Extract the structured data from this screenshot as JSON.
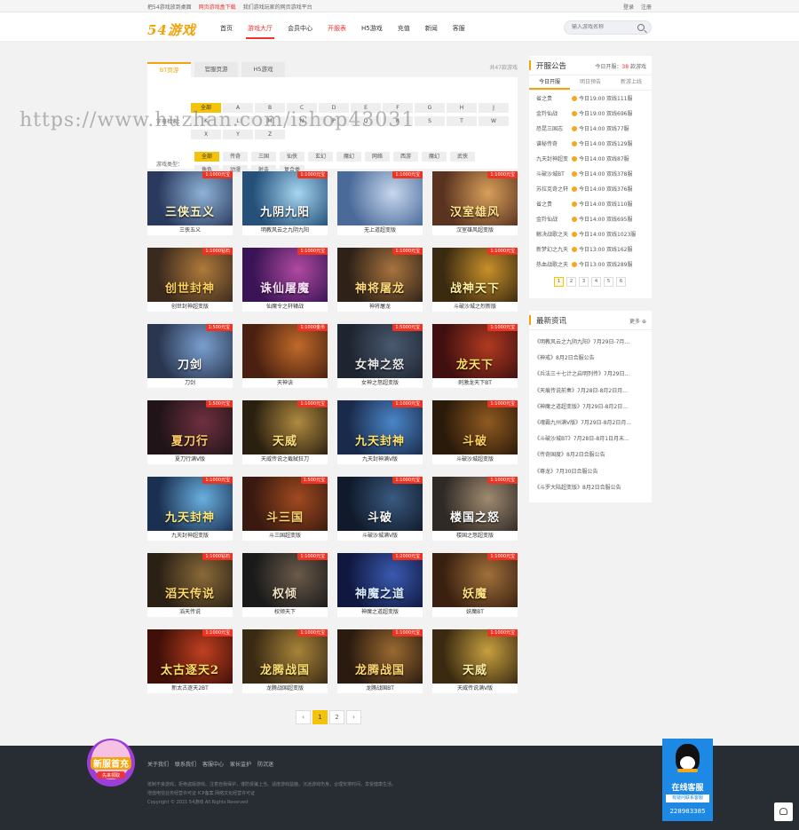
{
  "topbar": {
    "left": [
      "把54游戏放到桌面",
      "网页游戏盒下载",
      "我们游戏玩家的网页游戏平台"
    ],
    "right": [
      "登录",
      "注册"
    ]
  },
  "header": {
    "logo": "54游戏",
    "nav": [
      "首页",
      "游戏大厅",
      "会员中心",
      "开服表",
      "H5游戏",
      "充值",
      "新闻",
      "客服"
    ],
    "search_placeholder": "输入游戏名称"
  },
  "main": {
    "tabs": [
      "BT页游",
      "官服页游",
      "H5游戏"
    ],
    "total": "共47款游戏",
    "filter": {
      "letter_label": "字母检索：",
      "letters": [
        "全部",
        "A",
        "B",
        "C",
        "D",
        "E",
        "F",
        "G",
        "H",
        "J",
        "K",
        "L",
        "M",
        "N",
        "P",
        "Q",
        "R",
        "S",
        "T",
        "W",
        "X",
        "Y",
        "Z"
      ],
      "type_label": "游戏类型：",
      "types": [
        "全部",
        "传奇",
        "三国",
        "仙侠",
        "玄幻",
        "魔幻",
        "网络",
        "西游",
        "魔幻",
        "武侠",
        "角色",
        "动漫",
        "射击",
        "复合类"
      ]
    },
    "games": [
      {
        "name": "三侠五义",
        "badge": "1:1000元宝",
        "art": "三侠五义"
      },
      {
        "name": "明教风云之九阴九阳",
        "badge": "1:1000元宝",
        "art": "九阴九阳"
      },
      {
        "name": "无上道超变版",
        "badge": "1:1000元宝",
        "art": ""
      },
      {
        "name": "汉室雄风超变版",
        "badge": "1:1000元宝",
        "art": "汉室雄风"
      },
      {
        "name": "创世封神超变版",
        "badge": "1:1000钻石",
        "art": "创世封神"
      },
      {
        "name": "仙魔令之轩辕战",
        "badge": "1:1000元宝",
        "art": "诛仙屠魔"
      },
      {
        "name": "神将屠龙",
        "badge": "1:1000元宝",
        "art": "神将屠龙"
      },
      {
        "name": "斗破沙城之烈新版",
        "badge": "1:1000元宝",
        "art": "战神天下"
      },
      {
        "name": "刀剑",
        "badge": "1:500元宝",
        "art": "刀剑"
      },
      {
        "name": "天神诀",
        "badge": "1:1000金币",
        "art": ""
      },
      {
        "name": "女神之怒超变版",
        "badge": "1:5000元宝",
        "art": "女神之怒"
      },
      {
        "name": "刺激龙天下BT",
        "badge": "1:1000元宝",
        "art": "龙天下"
      },
      {
        "name": "夏刀行满V版",
        "badge": "1:500元宝",
        "art": "夏刀行"
      },
      {
        "name": "天威传说之截弑狂刀",
        "badge": "1:1000元宝",
        "art": "天威"
      },
      {
        "name": "九天封神满V版",
        "badge": "1:1000元宝",
        "art": "九天封神"
      },
      {
        "name": "斗破沙城超变版",
        "badge": "1:1000元宝",
        "art": "斗破"
      },
      {
        "name": "九天封神超变版",
        "badge": "1:1000元宝",
        "art": "九天封神"
      },
      {
        "name": "斗三国超变版",
        "badge": "1:500元宝",
        "art": "斗三国"
      },
      {
        "name": "斗破沙城满V版",
        "badge": "1:1000元宝",
        "art": "斗破"
      },
      {
        "name": "楼国之怒超变版",
        "badge": "1:1000元宝",
        "art": "楼国之怒"
      },
      {
        "name": "滔天传说",
        "badge": "1:1000钻石",
        "art": "滔天传说"
      },
      {
        "name": "权倾天下",
        "badge": "1:1000元宝",
        "art": "权倾"
      },
      {
        "name": "神魔之道超变版",
        "badge": "1:2000元宝",
        "art": "神魔之道"
      },
      {
        "name": "妖魔BT",
        "badge": "1:1000元宝",
        "art": "妖魔"
      },
      {
        "name": "新太古逐天2BT",
        "badge": "1:1000元宝",
        "art": "太古逐天2"
      },
      {
        "name": "龙腾战国超变版",
        "badge": "1:1000元宝",
        "art": "龙腾战国"
      },
      {
        "name": "龙腾战国BT",
        "badge": "1:1000元宝",
        "art": "龙腾战国"
      },
      {
        "name": "天威传说满V版",
        "badge": "1:1000元宝",
        "art": "天威"
      }
    ],
    "pager": [
      "‹",
      "1",
      "2",
      "›"
    ]
  },
  "server": {
    "title": "开服公告",
    "today_label": "今日开服：",
    "today_count": "38",
    "today_unit": "款游戏",
    "tabs": [
      "今日开服",
      "明日预告",
      "新游上线"
    ],
    "rows": [
      [
        "省之贵",
        "今日19:00",
        "双线111服"
      ],
      [
        "金羚仙战",
        "今日19:00",
        "双线696服"
      ],
      [
        "恐昆三国志",
        "今日14:00",
        "双线77服"
      ],
      [
        "谱秘传奇",
        "今日14:00",
        "双线129服"
      ],
      [
        "九天封神超变",
        "今日14:00",
        "双线87服"
      ],
      [
        "斗破沙城BT",
        "今日14:00",
        "双线378服"
      ],
      [
        "苏拉克奇之轩",
        "今日14:00",
        "双线376服"
      ],
      [
        "省之贵",
        "今日14:00",
        "双线110服"
      ],
      [
        "金羚仙战",
        "今日14:00",
        "双线695服"
      ],
      [
        "鲸决战歌之天",
        "今日14:00",
        "双线1023服"
      ],
      [
        "新梦幻之九天",
        "今日13:00",
        "双线162服"
      ],
      [
        "热血战歌之天",
        "今日13:00",
        "双线289服"
      ]
    ],
    "pages": [
      "1",
      "2",
      "3",
      "4",
      "5",
      "6"
    ]
  },
  "news": {
    "title": "最新资讯",
    "more": "更多",
    "items": [
      "《明教风云之九阴九阳》7月29日-7月...",
      "《神戒》8月2日合服公告",
      "《兵法三十七计之启明列传》7月29日...",
      "《天痕传说前奏》7月28日-8月2日月...",
      "《神魔之道超变版》7月29日-8月2日...",
      "《魂霸九州满V版》7月29日-8月2日月...",
      "《斗破沙城BT》7月28日-8月1日月末...",
      "《传奇国度》8月2日合服公告",
      "《尊龙》7月30日合服公告",
      "《斗罗大陆超变版》8月2日合服公告"
    ]
  },
  "footer": {
    "links": [
      "关于我们",
      "联系我们",
      "客服中心",
      "家长监护",
      "防沉迷"
    ],
    "lines": [
      "抵制不良游戏，拒绝盗版游戏。注意自我保护，谨防受骗上当。适度游戏益脑，沉迷游戏伤身。合理安排时间，享受健康生活。",
      "增值电信业务经营许可证 ICP备案 网络文化经营许可证",
      "Copyright © 2021 54游戏 All Rights Reserved"
    ],
    "promo": "新服首充",
    "promo_sub": "先来领取"
  },
  "qq": {
    "title": "在线客服",
    "sub": "有疑问联系客服",
    "number": "228983385"
  },
  "watermark": "https://www.huzhan.com/ishop43031",
  "colors": {
    "accent": "#f3c20b",
    "brand": "#f0a30a",
    "hot": "#e33",
    "footer": "#282c33"
  }
}
